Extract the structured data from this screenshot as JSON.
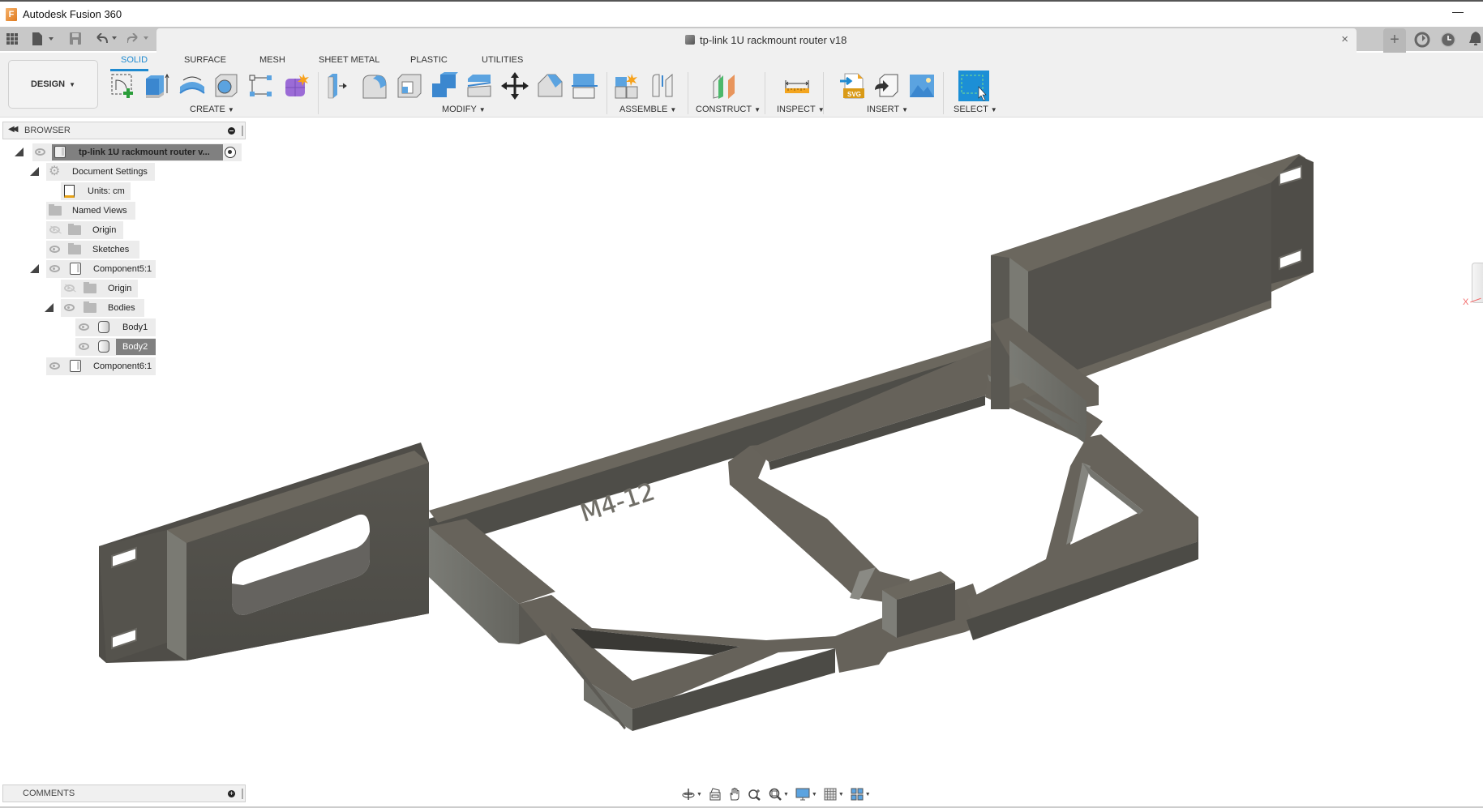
{
  "titlebar": {
    "app_title": "Autodesk Fusion 360",
    "minimize_label": "—"
  },
  "quick_access": {
    "icons": [
      "apps-grid-icon",
      "file-icon",
      "save-icon",
      "undo-icon",
      "redo-icon"
    ]
  },
  "document": {
    "title": "tp-link 1U rackmount router v18",
    "close_label": "×",
    "new_tab_label": "+"
  },
  "ribbon": {
    "workspace": "DESIGN",
    "tabs": [
      {
        "label": "SOLID",
        "active": true
      },
      {
        "label": "SURFACE",
        "active": false
      },
      {
        "label": "MESH",
        "active": false
      },
      {
        "label": "SHEET METAL",
        "active": false
      },
      {
        "label": "PLASTIC",
        "active": false
      },
      {
        "label": "UTILITIES",
        "active": false
      }
    ],
    "groups": [
      {
        "label": "CREATE",
        "tools": [
          "create-sketch",
          "extrude",
          "revolve",
          "hole",
          "pattern",
          "create-form"
        ]
      },
      {
        "label": "MODIFY",
        "tools": [
          "press-pull",
          "fillet",
          "shell",
          "combine",
          "offset-face",
          "move-copy",
          "chamfer",
          "split-body"
        ]
      },
      {
        "label": "ASSEMBLE",
        "tools": [
          "new-component",
          "joint"
        ]
      },
      {
        "label": "CONSTRUCT",
        "tools": [
          "offset-plane"
        ]
      },
      {
        "label": "INSPECT",
        "tools": [
          "measure"
        ]
      },
      {
        "label": "INSERT",
        "tools": [
          "insert-svg",
          "insert-derive",
          "insert-canvas"
        ]
      },
      {
        "label": "SELECT",
        "tools": [
          "select"
        ]
      }
    ],
    "svg_badge": "SVG"
  },
  "browser": {
    "title": "BROWSER",
    "tree": [
      {
        "label": "tp-link 1U rackmount router v...",
        "level": 0,
        "expanded": true,
        "icon": "component",
        "visible": true,
        "highlighted": true
      },
      {
        "label": "Document Settings",
        "level": 1,
        "expanded": true,
        "icon": "gear"
      },
      {
        "label": "Units: cm",
        "level": 2,
        "icon": "document"
      },
      {
        "label": "Named Views",
        "level": 1,
        "expanded": false,
        "icon": "folder"
      },
      {
        "label": "Origin",
        "level": 1,
        "expanded": false,
        "icon": "folder",
        "visible": false
      },
      {
        "label": "Sketches",
        "level": 1,
        "expanded": false,
        "icon": "folder",
        "visible": true
      },
      {
        "label": "Component5:1",
        "level": 1,
        "expanded": true,
        "icon": "component",
        "visible": true
      },
      {
        "label": "Origin",
        "level": 2,
        "expanded": false,
        "icon": "folder",
        "visible": false
      },
      {
        "label": "Bodies",
        "level": 2,
        "expanded": true,
        "icon": "folder",
        "visible": true
      },
      {
        "label": "Body1",
        "level": 3,
        "icon": "body",
        "visible": true
      },
      {
        "label": "Body2",
        "level": 3,
        "icon": "body",
        "visible": true,
        "selected": true
      },
      {
        "label": "Component6:1",
        "level": 1,
        "expanded": false,
        "icon": "component",
        "visible": true
      }
    ]
  },
  "viewport": {
    "embossed_text": "M4-12",
    "model_color": "#5c5a53",
    "axis_label": "X"
  },
  "comments": {
    "title": "COMMENTS"
  },
  "navbar": {
    "tools": [
      "orbit",
      "look-at",
      "pan",
      "zoom",
      "fit",
      "display-settings",
      "grid-settings",
      "viewports"
    ]
  },
  "colors": {
    "accent": "#1f8ad0",
    "ribbon_bg": "#f0f0f0",
    "quick_access_bg": "#c8c8c8",
    "selection": "#808080"
  }
}
